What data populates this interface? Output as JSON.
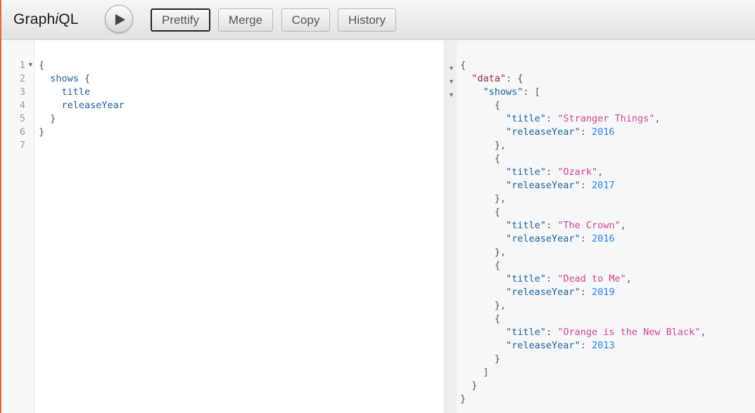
{
  "app": {
    "title_prefix": "Graph",
    "title_italic": "i",
    "title_suffix": "QL"
  },
  "toolbar": {
    "run_icon": "play-icon",
    "buttons": [
      {
        "label": "Prettify",
        "active": true
      },
      {
        "label": "Merge",
        "active": false
      },
      {
        "label": "Copy",
        "active": false
      },
      {
        "label": "History",
        "active": false
      }
    ]
  },
  "query_editor": {
    "line_numbers": [
      "1",
      "2",
      "3",
      "4",
      "5",
      "6",
      "7"
    ],
    "lines": [
      "{",
      "  shows {",
      "    title",
      "    releaseYear",
      "  }",
      "}",
      ""
    ]
  },
  "result": {
    "root_key": "data",
    "collection_key": "shows",
    "field_title": "title",
    "field_year": "releaseYear",
    "shows": [
      {
        "title": "Stranger Things",
        "releaseYear": "2016"
      },
      {
        "title": "Ozark",
        "releaseYear": "2017"
      },
      {
        "title": "The Crown",
        "releaseYear": "2016"
      },
      {
        "title": "Dead to Me",
        "releaseYear": "2019"
      },
      {
        "title": "Orange is the New Black",
        "releaseYear": "2013"
      }
    ]
  },
  "colors": {
    "accent": "#e8663d",
    "keyword": "#1f61a0",
    "string": "#d64292",
    "number": "#2882f9"
  }
}
